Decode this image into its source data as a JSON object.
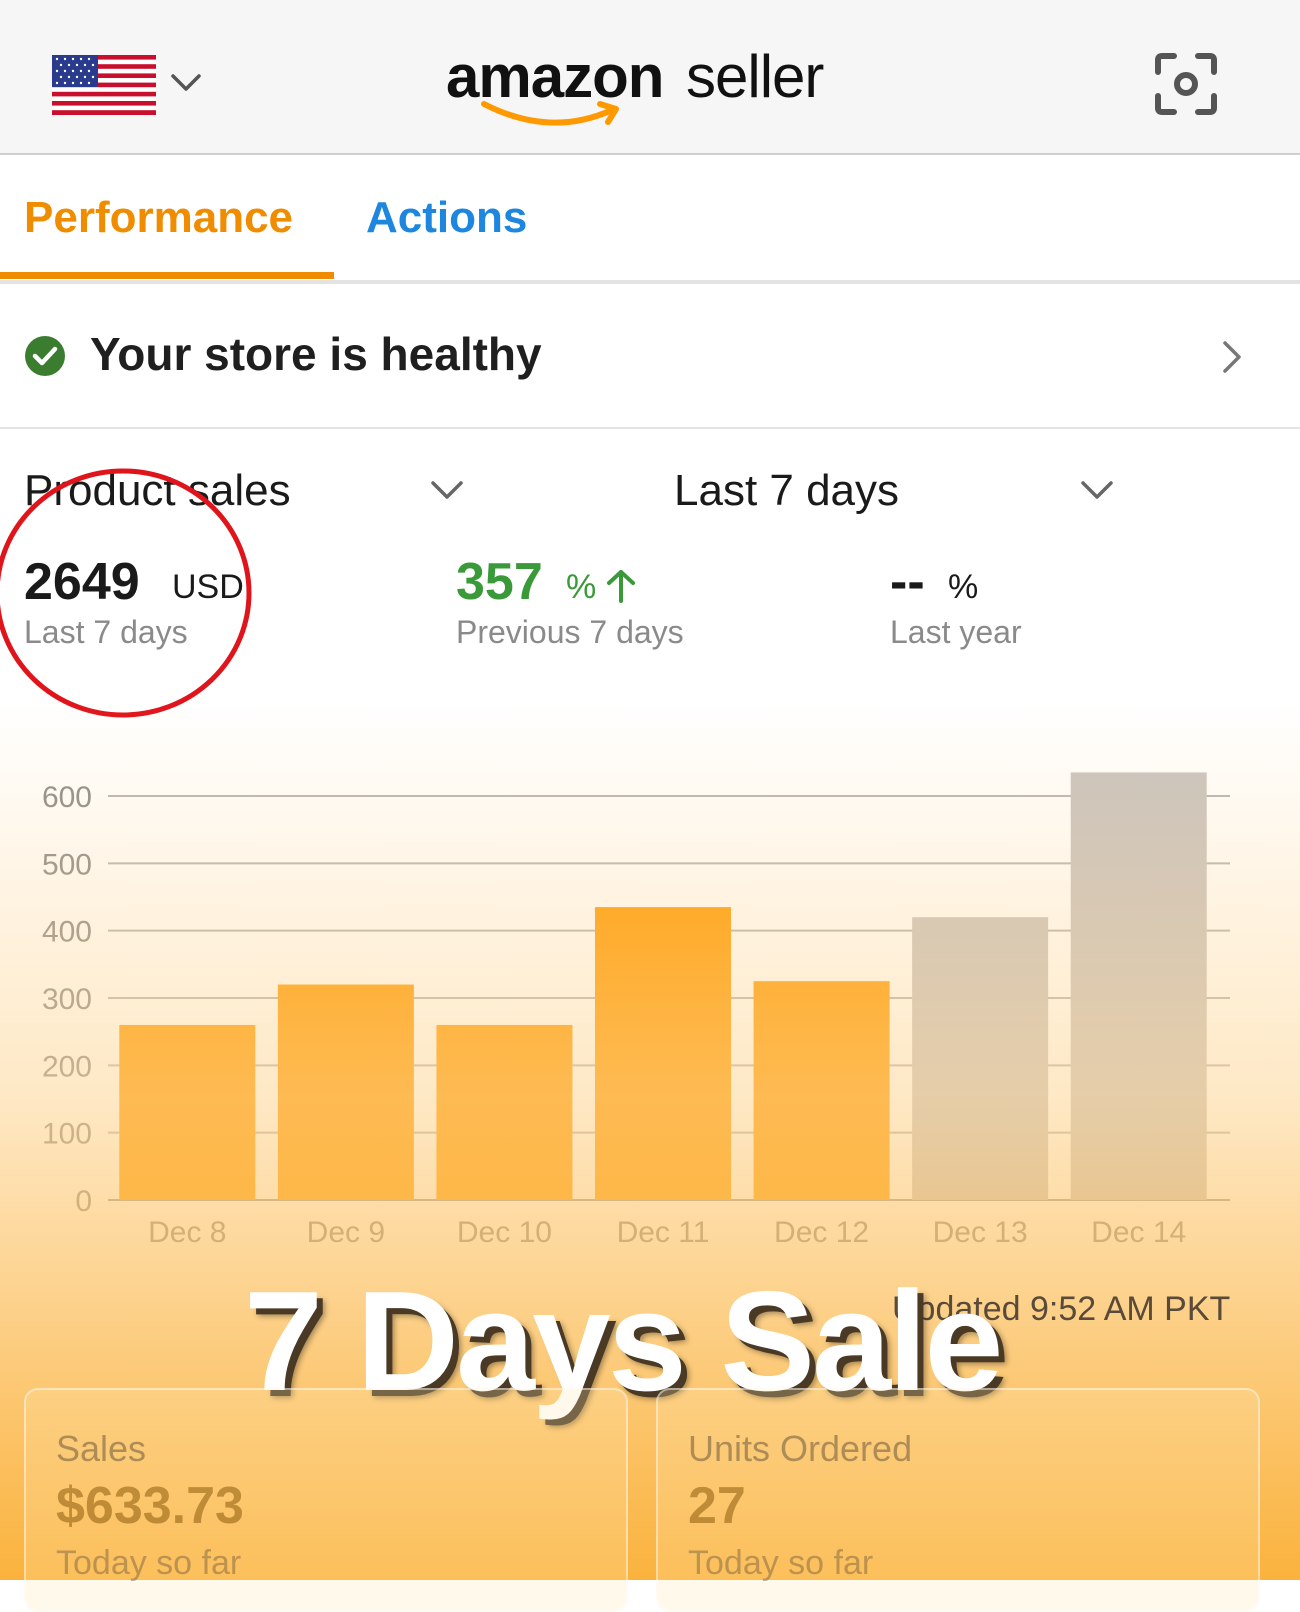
{
  "header": {
    "country_flag": "us-flag-icon",
    "logo_brand": "amazon",
    "logo_product": "seller",
    "scan_icon": "scan-camera-icon"
  },
  "tabs": [
    {
      "label": "Performance",
      "active": true,
      "color": "#f08c00"
    },
    {
      "label": "Actions",
      "active": false,
      "color": "#1d86de"
    }
  ],
  "health": {
    "status_text": "Your store is healthy",
    "status_color": "#3a7d2f"
  },
  "selectors": {
    "metric": "Product sales",
    "period": "Last 7 days"
  },
  "stats": {
    "total": {
      "value": "2649",
      "unit": "USD",
      "label": "Last 7 days"
    },
    "previous": {
      "value": "357",
      "unit": "%",
      "label": "Previous 7 days"
    },
    "last_year": {
      "value": "--",
      "unit": "%",
      "label": "Last year"
    }
  },
  "chart_data": {
    "type": "bar",
    "categories": [
      "Dec 8",
      "Dec 9",
      "Dec 10",
      "Dec 11",
      "Dec 12",
      "Dec 13",
      "Dec 14"
    ],
    "values": [
      260,
      320,
      260,
      435,
      325,
      420,
      635
    ],
    "ylim": [
      0,
      600
    ],
    "yticks": [
      0,
      100,
      200,
      300,
      400,
      500,
      600
    ],
    "grid": true,
    "bar_colors": [
      "#ff9a00",
      "#ff9a00",
      "#ff9a00",
      "#ff9a00",
      "#ff9a00",
      "#c8c3c0",
      "#c8c3c0"
    ]
  },
  "updated_text": "Updated 9:52 AM PKT",
  "overlay_title": "7 Days Sale",
  "cards": [
    {
      "title": "Sales",
      "value": "$633.73",
      "sub": "Today so far"
    },
    {
      "title": "Units Ordered",
      "value": "27",
      "sub": "Today so far"
    }
  ],
  "colors": {
    "accent": "#f08c00",
    "link": "#1d86de",
    "positive": "#3a9a3a",
    "annotation": "#e0141b"
  }
}
